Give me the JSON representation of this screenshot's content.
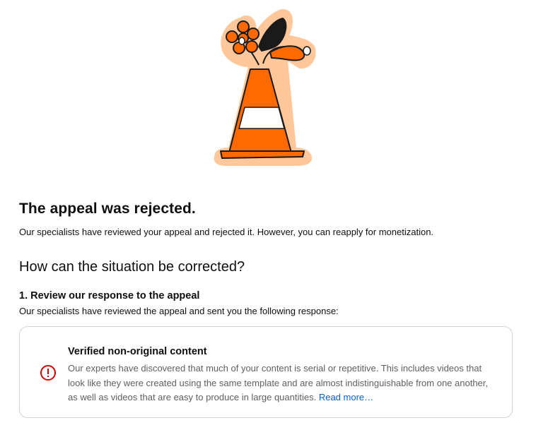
{
  "page": {
    "title": "The appeal was rejected.",
    "subtitle": "Our specialists have reviewed your appeal and rejected it. However, you can reapply for monetization.",
    "section_heading": "How can the situation be corrected?",
    "step": {
      "title": "1. Review our response to the appeal",
      "description": "Our specialists have reviewed the appeal and sent you the following response:"
    }
  },
  "response_card": {
    "icon": "error-icon",
    "title": "Verified non-original content",
    "body": "Our experts have discovered that much of your content is serial or repetitive. This includes videos that look like they were created using the same template and are almost indistinguishable from one another, as well as videos that are easy to produce in large quantities. ",
    "read_more_label": "Read more…"
  },
  "illustration": {
    "icon": "traffic-cone-with-flowers-icon"
  },
  "colors": {
    "accent_orange": "#ff6a00",
    "soft_orange": "#ffc79a",
    "error_red": "#cc0000",
    "link_blue": "#065fd4"
  }
}
